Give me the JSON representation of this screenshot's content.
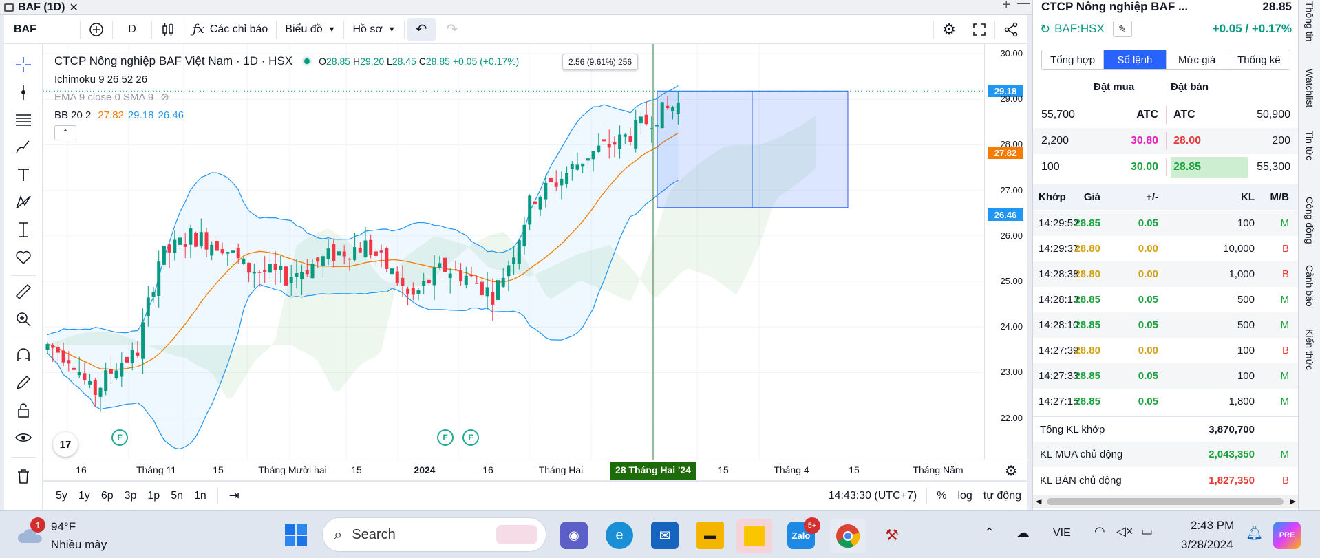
{
  "window": {
    "tab_title": "BAF (1D)",
    "close": "✕",
    "add": "+",
    "minimize": "—"
  },
  "toolbar": {
    "symbol": "BAF",
    "interval": "D",
    "indicators_label": "Các chỉ báo",
    "chart_type_label": "Biểu đồ",
    "profile_label": "Hồ sơ"
  },
  "legend": {
    "title": "CTCP Nông nghiệp BAF Việt Nam · 1D · HSX",
    "o_label": "O",
    "o": "28.85",
    "h_label": "H",
    "h": "29.20",
    "l_label": "L",
    "l": "28.45",
    "c_label": "C",
    "c": "28.85",
    "change": "+0.05 (+0.17%)",
    "ichimoku": "Ichimoku 9 26 52 26",
    "ema_sma": "EMA 9 close 0 SMA 9",
    "bb_label": "BB 20 2",
    "bb_basis": "27.82",
    "bb_upper": "29.18",
    "bb_lower": "26.46",
    "collapse": "⌃"
  },
  "measure": {
    "text": "2.56 (9.61%) 256"
  },
  "earnings_marker": "F",
  "tv_logo": "17",
  "price_axis": {
    "labels": [
      "30.00",
      "29.00",
      "28.00",
      "27.00",
      "26.00",
      "25.00",
      "24.00",
      "23.00",
      "22.00"
    ],
    "tag_upper": "29.18",
    "tag_mid": "27.82",
    "tag_lower": "26.46",
    "colors": {
      "upper": "#2196f3",
      "mid": "#f57c00",
      "lower": "#2196f3"
    }
  },
  "time_axis": {
    "labels": [
      "16",
      "Tháng 11",
      "15",
      "Tháng Mười hai",
      "15",
      "2024",
      "16",
      "Tháng Hai",
      "15",
      "Tháng 4",
      "15",
      "Tháng Năm"
    ],
    "crosshair": "28 Tháng Hai '24"
  },
  "bottom": {
    "ranges": [
      "5y",
      "1y",
      "6p",
      "3p",
      "1p",
      "5n",
      "1n"
    ],
    "clock": "14:43:30 (UTC+7)",
    "pct": "%",
    "log": "log",
    "auto": "tự động"
  },
  "panel": {
    "name": "CTCP Nông nghiệp BAF ...",
    "price": "28.85",
    "symbol": "BAF:HSX",
    "change": "+0.05 / +0.17%",
    "tabs": [
      "Tổng hợp",
      "Sổ lệnh",
      "Mức giá",
      "Thống kê"
    ],
    "active_tab": 1,
    "ob_header": {
      "buy": "Đặt mua",
      "sell": "Đặt bán"
    },
    "orderbook": [
      {
        "bvol": "55,700",
        "bprice": "ATC",
        "sprice": "ATC",
        "svol": "50,900",
        "bcolor": "#131722",
        "scolor": "#131722"
      },
      {
        "bvol": "2,200",
        "bprice": "30.80",
        "sprice": "28.00",
        "svol": "200",
        "bcolor": "#e91ec4",
        "scolor": "#e53935"
      },
      {
        "bvol": "100",
        "bprice": "30.00",
        "sprice": "28.85",
        "svol": "55,300",
        "bcolor": "#1aa33b",
        "scolor": "#1aa33b"
      }
    ],
    "trades_header": {
      "time": "Khớp",
      "price": "Giá",
      "chg": "+/-",
      "vol": "KL",
      "side": "M/B"
    },
    "trades": [
      {
        "time": "14:29:52",
        "price": "28.85",
        "chg": "0.05",
        "vol": "100",
        "side": "M"
      },
      {
        "time": "14:29:37",
        "price": "28.80",
        "chg": "0.00",
        "vol": "10,000",
        "side": "B"
      },
      {
        "time": "14:28:38",
        "price": "28.80",
        "chg": "0.00",
        "vol": "1,000",
        "side": "B"
      },
      {
        "time": "14:28:13",
        "price": "28.85",
        "chg": "0.05",
        "vol": "500",
        "side": "M"
      },
      {
        "time": "14:28:10",
        "price": "28.85",
        "chg": "0.05",
        "vol": "500",
        "side": "M"
      },
      {
        "time": "14:27:39",
        "price": "28.80",
        "chg": "0.00",
        "vol": "100",
        "side": "B"
      },
      {
        "time": "14:27:33",
        "price": "28.85",
        "chg": "0.05",
        "vol": "100",
        "side": "M"
      },
      {
        "time": "14:27:15",
        "price": "28.85",
        "chg": "0.05",
        "vol": "1,800",
        "side": "M"
      }
    ],
    "summary": [
      {
        "label": "Tổng KL khớp",
        "value": "3,870,700",
        "tag": "",
        "color": "#131722"
      },
      {
        "label": "KL MUA chủ động",
        "value": "2,043,350",
        "tag": "M",
        "color": "#1aa33b"
      },
      {
        "label": "KL BÁN chủ động",
        "value": "1,827,350",
        "tag": "B",
        "color": "#e53935"
      }
    ]
  },
  "side_tabs": [
    "Thông tin",
    "Watchlist",
    "Tin tức",
    "Công đồng",
    "Cảnh báo",
    "Kiến thức"
  ],
  "taskbar": {
    "weather_temp": "94°F",
    "weather_desc": "Nhiều mây",
    "weather_badge": "1",
    "search_placeholder": "Search",
    "zalo_badge": "5+",
    "lang": "VIE",
    "time": "2:43 PM",
    "date": "3/28/2024"
  }
}
